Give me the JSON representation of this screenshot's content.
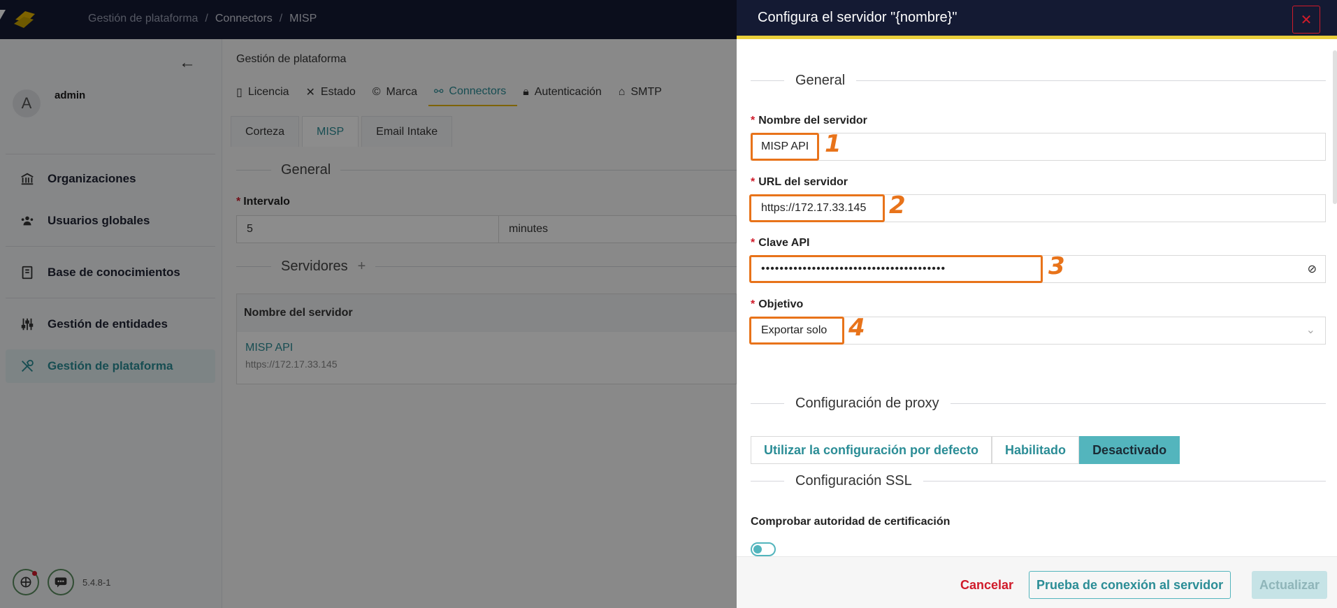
{
  "breadcrumb": [
    "Gestión de plataforma",
    "Connectors",
    "MISP"
  ],
  "user": {
    "initial": "A",
    "name": "admin"
  },
  "sidebar": {
    "items": [
      {
        "label": "Organizaciones",
        "icon": "institution-icon"
      },
      {
        "label": "Usuarios globales",
        "icon": "users-icon"
      },
      {
        "label": "Base de conocimientos",
        "icon": "book-icon"
      },
      {
        "label": "Gestión de entidades",
        "icon": "sliders-icon"
      },
      {
        "label": "Gestión de plataforma",
        "icon": "tools-icon",
        "active": true
      }
    ]
  },
  "version": "5.4.8-1",
  "main": {
    "title": "Gestión de plataforma",
    "tabs": [
      "Licencia",
      "Estado",
      "Marca",
      "Connectors",
      "Autenticación",
      "SMTP"
    ],
    "subtabs": [
      "Corteza",
      "MISP",
      "Email Intake"
    ],
    "general_title": "General",
    "interval_label": "Intervalo",
    "interval_value": "5",
    "interval_unit": "minutes",
    "servers_title": "Servidores",
    "table_header": "Nombre del servidor",
    "server_name": "MISP API",
    "server_url": "https://172.17.33.145"
  },
  "drawer": {
    "title": "Configura el servidor \"{nombre}\"",
    "general_title": "General",
    "name_label": "Nombre del servidor",
    "name_value": "MISP API",
    "url_label": "URL del servidor",
    "url_value": "https://172.17.33.145",
    "key_label": "Clave API",
    "key_value": "••••••••••••••••••••••••••••••••••••••••",
    "purpose_label": "Objetivo",
    "purpose_value": "Exportar solo",
    "proxy_title": "Configuración de proxy",
    "proxy_options": [
      "Utilizar la configuración por defecto",
      "Habilitado",
      "Desactivado"
    ],
    "proxy_selected": "Desactivado",
    "ssl_title": "Configuración SSL",
    "ssl_check_label": "Comprobar autoridad de certificación",
    "markers": [
      "1",
      "2",
      "3",
      "4"
    ],
    "cancel": "Cancelar",
    "test": "Prueba de conexión al servidor",
    "update": "Actualizar"
  },
  "colors": {
    "accent": "#2b8d96",
    "highlight": "#e8731a",
    "danger": "#d01b2a",
    "header": "#141a33"
  }
}
